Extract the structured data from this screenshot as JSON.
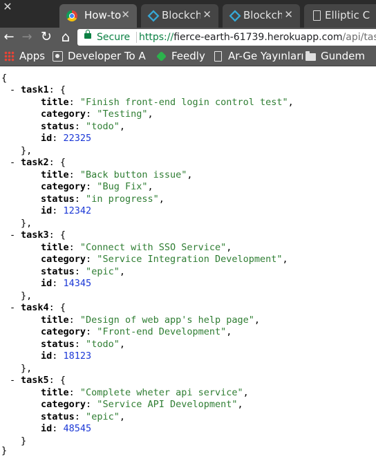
{
  "window": {
    "close_glyph": "✕"
  },
  "tabs": [
    {
      "title": "How-to C",
      "favicon": "chrome-icon",
      "active": true,
      "close": "✕"
    },
    {
      "title": "Blockcha",
      "favicon": "diamond-icon",
      "active": false,
      "close": "✕"
    },
    {
      "title": "Blockcha",
      "favicon": "diamond-icon",
      "active": false,
      "close": "✕"
    },
    {
      "title": "Elliptic C",
      "favicon": "document-icon",
      "active": false,
      "close": "✕"
    }
  ],
  "nav": {
    "back": "←",
    "forward": "→",
    "reload": "↻",
    "home": "⌂"
  },
  "address": {
    "security_label": "Secure",
    "scheme": "https://",
    "host": "fierce-earth-61739.herokuapp.com",
    "path": "/api/tasks"
  },
  "bookmarks": [
    {
      "label": "Apps",
      "icon": "apps-grid-icon"
    },
    {
      "label": "Developer To Ar",
      "icon": "developer-icon"
    },
    {
      "label": "Feedly",
      "icon": "feedly-icon"
    },
    {
      "label": "Ar-Ge Yayınları",
      "icon": "document-icon"
    },
    {
      "label": "Gundem",
      "icon": "folder-icon"
    }
  ],
  "json": {
    "open_brace": "{",
    "close_brace": "}",
    "toggle": "-",
    "tasks": [
      {
        "name": "task1",
        "title": "Finish front-end login control test",
        "category": "Testing",
        "status": "todo",
        "id": 22325
      },
      {
        "name": "task2",
        "title": "Back button issue",
        "category": "Bug Fix",
        "status": "in progress",
        "id": 12342
      },
      {
        "name": "task3",
        "title": "Connect with SSO Service",
        "category": "Service Integration Development",
        "status": "epic",
        "id": 14345
      },
      {
        "name": "task4",
        "title": "Design of web app's help page",
        "category": "Front-end Development",
        "status": "todo",
        "id": 18123
      },
      {
        "name": "task5",
        "title": "Complete wheter api service",
        "category": "Service API Development",
        "status": "epic",
        "id": 48545
      }
    ]
  },
  "colors": {
    "string": "#2e7d32",
    "number": "#1a37d6",
    "secure": "#0b8043",
    "chrome": "#595959"
  }
}
